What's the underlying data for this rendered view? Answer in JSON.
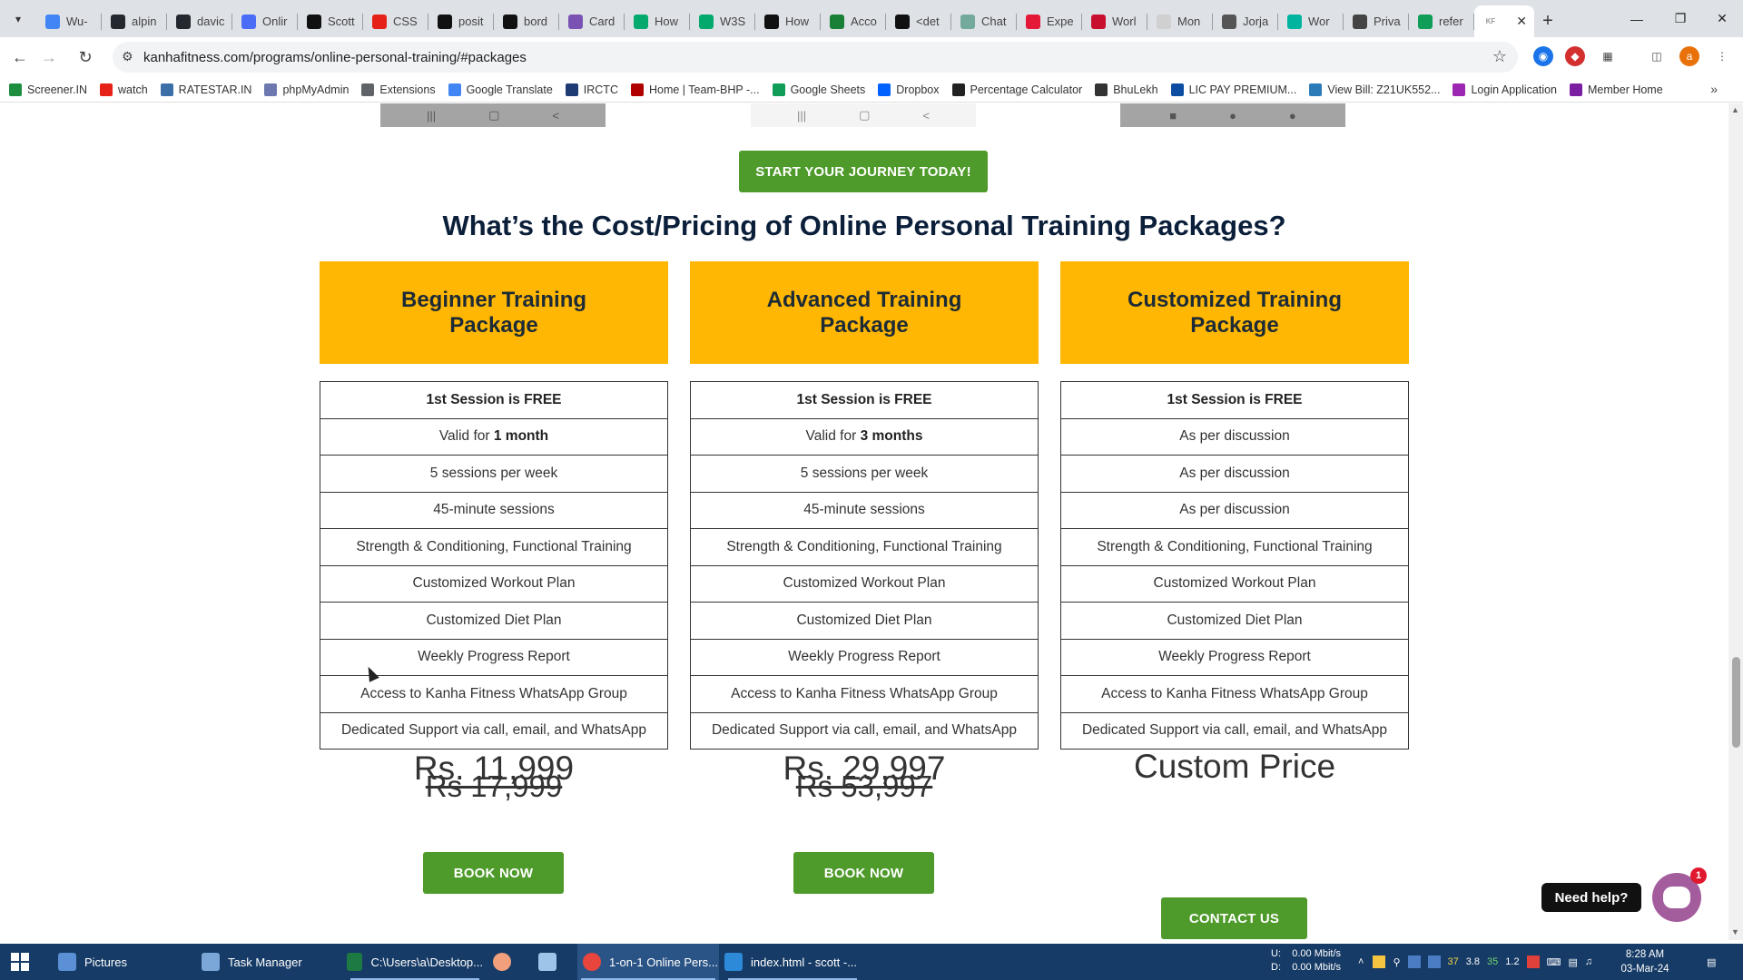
{
  "browser": {
    "tabs": [
      {
        "title": "Wu-",
        "color": "#4285f4",
        "icon": "google-icon"
      },
      {
        "title": "alpin",
        "color": "#24292f",
        "icon": "github-icon"
      },
      {
        "title": "davic",
        "color": "#24292f",
        "icon": "github-icon"
      },
      {
        "title": "Onlir",
        "color": "#4a6cf7",
        "icon": "site-icon"
      },
      {
        "title": "Scott",
        "color": "#111111",
        "icon": "site-icon"
      },
      {
        "title": "CSS",
        "color": "#e62117",
        "icon": "youtube-icon"
      },
      {
        "title": "posit",
        "color": "#111111",
        "icon": "site-icon"
      },
      {
        "title": "bord",
        "color": "#111111",
        "icon": "site-icon"
      },
      {
        "title": "Card",
        "color": "#7952b3",
        "icon": "bootstrap-icon"
      },
      {
        "title": "How",
        "color": "#04aa6d",
        "icon": "w3-icon"
      },
      {
        "title": "W3S",
        "color": "#04aa6d",
        "icon": "w3-icon"
      },
      {
        "title": "How",
        "color": "#111111",
        "icon": "site-icon"
      },
      {
        "title": "Acco",
        "color": "#1a7f37",
        "icon": "site-icon"
      },
      {
        "title": "<det",
        "color": "#111111",
        "icon": "site-icon"
      },
      {
        "title": "Chat",
        "color": "#74aa9c",
        "icon": "chatgpt-icon"
      },
      {
        "title": "Expe",
        "color": "#e31937",
        "icon": "site-icon"
      },
      {
        "title": "Worl",
        "color": "#c8102e",
        "icon": "site-icon"
      },
      {
        "title": "Mon",
        "color": "#d0d0d0",
        "icon": "site-icon"
      },
      {
        "title": "Jorja",
        "color": "#555555",
        "icon": "site-icon"
      },
      {
        "title": "Wor",
        "color": "#00b4a0",
        "icon": "site-icon"
      },
      {
        "title": "Priva",
        "color": "#444444",
        "icon": "site-icon"
      },
      {
        "title": "refer",
        "color": "#0f9d58",
        "icon": "sheets-icon"
      }
    ],
    "active_tab": {
      "title": "KF",
      "color": "#bbbbbb"
    },
    "url": "kanhafitness.com/programs/online-personal-training/#packages",
    "bookmarks": [
      {
        "label": "Screener.IN",
        "color": "#1e8e3e"
      },
      {
        "label": "watch",
        "color": "#e62117"
      },
      {
        "label": "RATESTAR.IN",
        "color": "#3c6ea8"
      },
      {
        "label": "phpMyAdmin",
        "color": "#6c78af"
      },
      {
        "label": "Extensions",
        "color": "#5f6368"
      },
      {
        "label": "Google Translate",
        "color": "#4285f4"
      },
      {
        "label": "IRCTC",
        "color": "#1f3b73"
      },
      {
        "label": "Home | Team-BHP -...",
        "color": "#b00000"
      },
      {
        "label": "Google Sheets",
        "color": "#0f9d58"
      },
      {
        "label": "Dropbox",
        "color": "#0061ff"
      },
      {
        "label": "Percentage Calculator",
        "color": "#222222"
      },
      {
        "label": "BhuLekh",
        "color": "#333333"
      },
      {
        "label": "LIC PAY PREMIUM...",
        "color": "#0c4da2"
      },
      {
        "label": "View Bill: Z21UK552...",
        "color": "#2b7bb9"
      },
      {
        "label": "Login Application",
        "color": "#9c27b0"
      },
      {
        "label": "Member Home",
        "color": "#7b1fa2"
      }
    ]
  },
  "page": {
    "cta_label": "START YOUR JOURNEY TODAY!",
    "section_title": "What’s the Cost/Pricing of Online Personal Training Packages?",
    "packages": [
      {
        "title_line1": "Beginner Training",
        "title_line2": "Package",
        "rows": [
          "1st Session is FREE",
          "Valid for ",
          "5 sessions per week",
          "45-minute sessions",
          "Strength & Conditioning, Functional Training",
          "Customized Workout Plan",
          "Customized Diet Plan",
          "Weekly Progress Report",
          "Access to Kanha Fitness WhatsApp Group",
          "Dedicated Support via call, email, and WhatsApp"
        ],
        "validity": "1 month",
        "price": "Rs. 11,999",
        "old_price": "Rs 17,999",
        "button": "BOOK NOW"
      },
      {
        "title_line1": "Advanced Training",
        "title_line2": "Package",
        "rows": [
          "1st Session is FREE",
          "Valid for ",
          "5 sessions per week",
          "45-minute sessions",
          "Strength & Conditioning, Functional Training",
          "Customized Workout Plan",
          "Customized Diet Plan",
          "Weekly Progress Report",
          "Access to Kanha Fitness WhatsApp Group",
          "Dedicated Support via call, email, and WhatsApp"
        ],
        "validity": "3 months",
        "price": "Rs. 29,997",
        "old_price": "Rs 53,997",
        "button": "BOOK NOW"
      },
      {
        "title_line1": "Customized Training",
        "title_line2": "Package",
        "rows": [
          "1st Session is FREE",
          "As per discussion",
          "As per discussion",
          "As per discussion",
          "Strength & Conditioning, Functional Training",
          "Customized Workout Plan",
          "Customized Diet Plan",
          "Weekly Progress Report",
          "Access to Kanha Fitness WhatsApp Group",
          "Dedicated Support via call, email, and WhatsApp"
        ],
        "price": "Custom Price",
        "button": "CONTACT US"
      }
    ],
    "need_help": "Need help?",
    "chat_badge": "1",
    "colors": {
      "accent_yellow": "#ffb703",
      "button_green": "#4e9a2a",
      "title_navy": "#0b1f3a"
    }
  },
  "taskbar": {
    "items": [
      "Pictures",
      "Task Manager",
      "C:\\Users\\a\\Desktop...",
      "1-on-1 Online Pers...",
      "index.html - scott -..."
    ],
    "net_up": "0.00 Mbit/s",
    "net_down": "0.00 Mbit/s",
    "net_up_label": "U:",
    "net_down_label": "D:",
    "tray_numbers": [
      "37",
      "3.8",
      "35",
      "1.2"
    ],
    "time": "8:28 AM",
    "date": "03-Mar-24"
  }
}
